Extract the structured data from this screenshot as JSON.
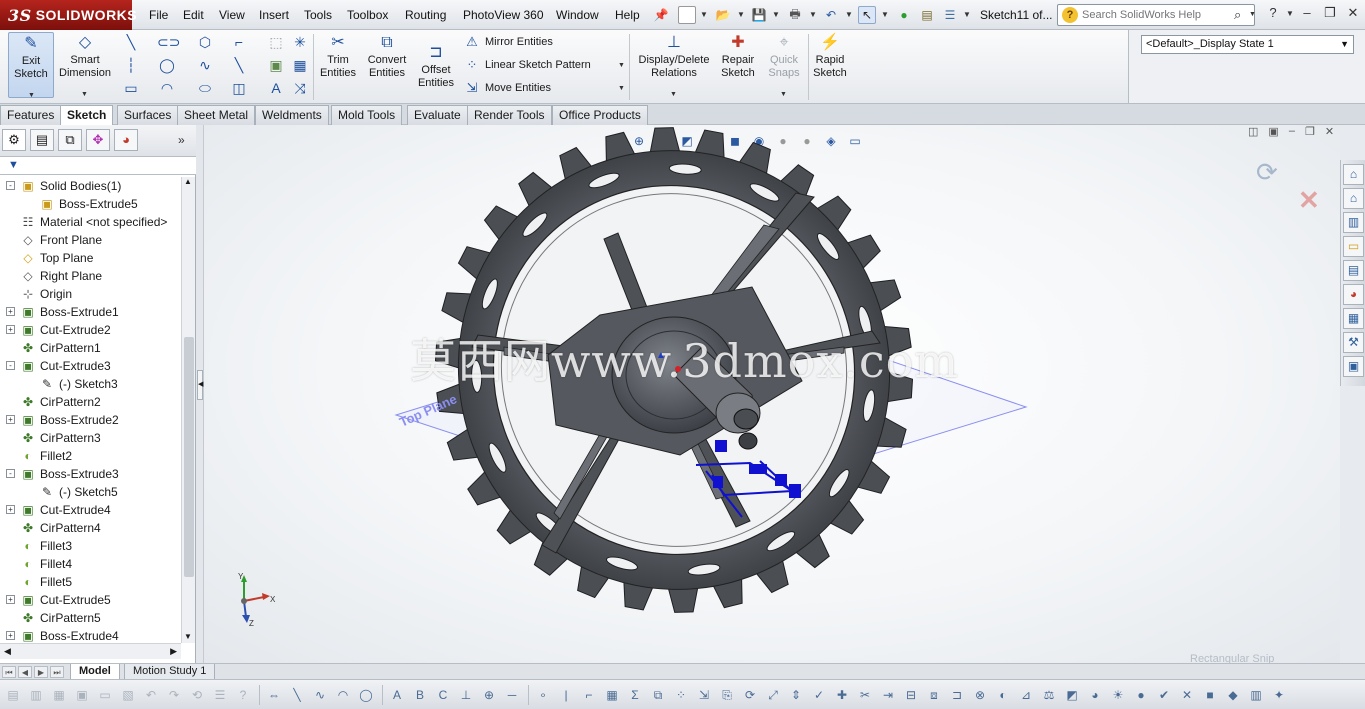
{
  "app": {
    "brand_ds": "3S",
    "brand": "SOLIDWORKS"
  },
  "menu": [
    "File",
    "Edit",
    "View",
    "Insert",
    "Tools",
    "Toolbox",
    "Routing",
    "PhotoView 360",
    "Window",
    "Help"
  ],
  "document_title": "Sketch11 of...",
  "search": {
    "placeholder": "Search SolidWorks Help"
  },
  "command_manager": {
    "exit_sketch": [
      "Exit",
      "Sketch"
    ],
    "smart_dimension": [
      "Smart",
      "Dimension"
    ],
    "trim_entities": [
      "Trim",
      "Entities"
    ],
    "convert_entities": [
      "Convert",
      "Entities"
    ],
    "offset_entities": [
      "Offset",
      "Entities"
    ],
    "mirror_entities": "Mirror Entities",
    "linear_sketch_pattern": "Linear Sketch Pattern",
    "move_entities": "Move Entities",
    "display_delete_relations": [
      "Display/Delete",
      "Relations"
    ],
    "repair_sketch": [
      "Repair",
      "Sketch"
    ],
    "quick_snaps": [
      "Quick",
      "Snaps"
    ],
    "rapid_sketch": [
      "Rapid",
      "Sketch"
    ]
  },
  "display_state": "<Default>_Display State 1",
  "tabs": [
    {
      "label": "Features",
      "active": false
    },
    {
      "label": "Sketch",
      "active": true
    },
    {
      "label": "Surfaces",
      "active": false
    },
    {
      "label": "Sheet Metal",
      "active": false
    },
    {
      "label": "Weldments",
      "active": false
    },
    {
      "label": "Mold Tools",
      "active": false
    },
    {
      "label": "Evaluate",
      "active": false
    },
    {
      "label": "Render Tools",
      "active": false
    },
    {
      "label": "Office Products",
      "active": false
    }
  ],
  "feature_tree": [
    {
      "label": "Solid Bodies(1)",
      "icon": "folder-icon",
      "level": 0,
      "exp": "-"
    },
    {
      "label": "Boss-Extrude5",
      "icon": "body-icon",
      "level": 1,
      "exp": ""
    },
    {
      "label": "Material <not specified>",
      "icon": "material-icon",
      "level": 0,
      "exp": ""
    },
    {
      "label": "Front Plane",
      "icon": "plane-icon",
      "level": 0,
      "exp": ""
    },
    {
      "label": "Top Plane",
      "icon": "plane-icon",
      "level": 0,
      "exp": "",
      "highlight": true
    },
    {
      "label": "Right Plane",
      "icon": "plane-icon",
      "level": 0,
      "exp": ""
    },
    {
      "label": "Origin",
      "icon": "origin-icon",
      "level": 0,
      "exp": ""
    },
    {
      "label": "Boss-Extrude1",
      "icon": "extrude-icon",
      "level": 0,
      "exp": "+"
    },
    {
      "label": "Cut-Extrude2",
      "icon": "cut-icon",
      "level": 0,
      "exp": "+"
    },
    {
      "label": "CirPattern1",
      "icon": "pattern-icon",
      "level": 0,
      "exp": ""
    },
    {
      "label": "Cut-Extrude3",
      "icon": "cut-icon",
      "level": 0,
      "exp": "-"
    },
    {
      "label": "(-) Sketch3",
      "icon": "sketch-icon",
      "level": 1,
      "exp": ""
    },
    {
      "label": "CirPattern2",
      "icon": "pattern-icon",
      "level": 0,
      "exp": ""
    },
    {
      "label": "Boss-Extrude2",
      "icon": "extrude-icon",
      "level": 0,
      "exp": "+"
    },
    {
      "label": "CirPattern3",
      "icon": "pattern-icon",
      "level": 0,
      "exp": ""
    },
    {
      "label": "Fillet2",
      "icon": "fillet-icon",
      "level": 0,
      "exp": ""
    },
    {
      "label": "Boss-Extrude3",
      "icon": "extrude-icon",
      "level": 0,
      "exp": "-"
    },
    {
      "label": "(-) Sketch5",
      "icon": "sketch-icon",
      "level": 1,
      "exp": ""
    },
    {
      "label": "Cut-Extrude4",
      "icon": "cut-icon",
      "level": 0,
      "exp": "+"
    },
    {
      "label": "CirPattern4",
      "icon": "pattern-icon",
      "level": 0,
      "exp": ""
    },
    {
      "label": "Fillet3",
      "icon": "fillet-icon",
      "level": 0,
      "exp": ""
    },
    {
      "label": "Fillet4",
      "icon": "fillet-icon",
      "level": 0,
      "exp": ""
    },
    {
      "label": "Fillet5",
      "icon": "fillet-icon",
      "level": 0,
      "exp": ""
    },
    {
      "label": "Cut-Extrude5",
      "icon": "cut-icon",
      "level": 0,
      "exp": "+"
    },
    {
      "label": "CirPattern5",
      "icon": "pattern-icon",
      "level": 0,
      "exp": ""
    },
    {
      "label": "Boss-Extrude4",
      "icon": "extrude-icon",
      "level": 0,
      "exp": "+"
    }
  ],
  "viewport": {
    "plane_label": "Top Plane",
    "watermark": "莫西网www.3dmox.com",
    "triad": {
      "x": "X",
      "y": "Y",
      "z": "Z"
    },
    "snip_hint": "Rectangular Snip"
  },
  "bottom_tabs": [
    {
      "label": "Model",
      "active": true
    },
    {
      "label": "Motion Study 1",
      "active": false
    }
  ],
  "colors": {
    "accent": "#1d4f9c",
    "brand": "#a11b14",
    "part": "#4b4d52",
    "sketch": "#1010d0"
  }
}
